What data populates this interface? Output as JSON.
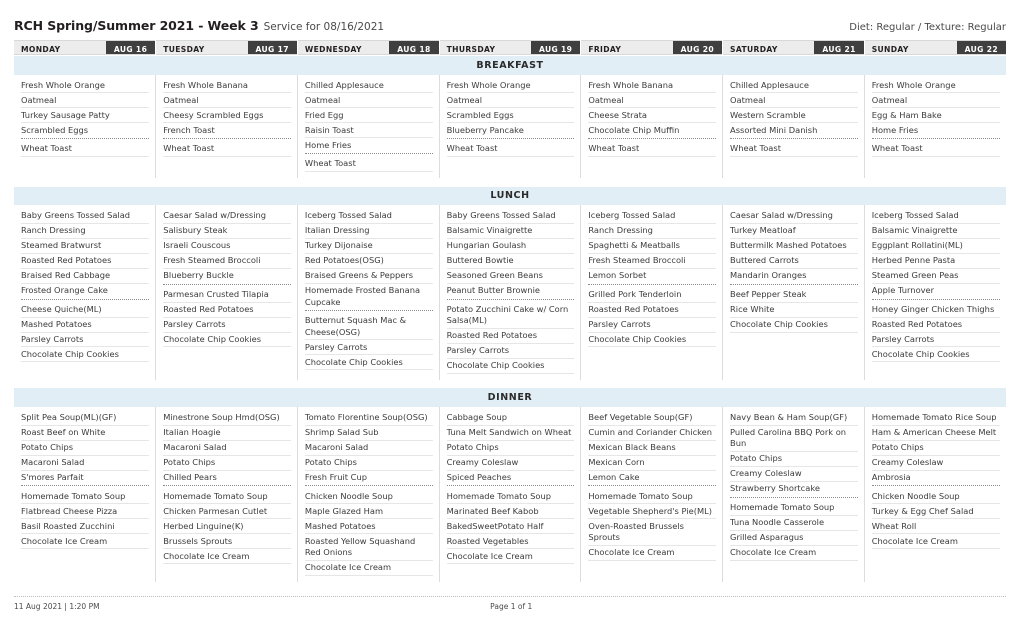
{
  "header": {
    "title": "RCH Spring/Summer 2021 - Week 3",
    "service_for": "Service for 08/16/2021",
    "diet_info": "Diet: Regular / Texture: Regular"
  },
  "days": [
    {
      "name": "MONDAY",
      "date": "AUG 16"
    },
    {
      "name": "TUESDAY",
      "date": "AUG 17"
    },
    {
      "name": "WEDNESDAY",
      "date": "AUG 18"
    },
    {
      "name": "THURSDAY",
      "date": "AUG 19"
    },
    {
      "name": "FRIDAY",
      "date": "AUG 20"
    },
    {
      "name": "SATURDAY",
      "date": "AUG 21"
    },
    {
      "name": "SUNDAY",
      "date": "AUG 22"
    }
  ],
  "meals": [
    {
      "label": "BREAKFAST",
      "columns": [
        [
          "Fresh Whole Orange",
          "Oatmeal",
          "Turkey Sausage Patty",
          "Scrambled Eggs",
          "|",
          "Wheat Toast"
        ],
        [
          "Fresh Whole Banana",
          "Oatmeal",
          "Cheesy Scrambled Eggs",
          "French Toast",
          "|",
          "Wheat Toast"
        ],
        [
          "Chilled Applesauce",
          "Oatmeal",
          "Fried Egg",
          "Raisin Toast",
          "Home Fries",
          "|",
          "Wheat Toast"
        ],
        [
          "Fresh Whole Orange",
          "Oatmeal",
          "Scrambled Eggs",
          "Blueberry Pancake",
          "|",
          "Wheat Toast"
        ],
        [
          "Fresh Whole Banana",
          "Oatmeal",
          "Cheese Strata",
          "Chocolate Chip Muffin",
          "|",
          "Wheat Toast"
        ],
        [
          "Chilled Applesauce",
          "Oatmeal",
          "Western Scramble",
          "Assorted Mini Danish",
          "|",
          "Wheat Toast"
        ],
        [
          "Fresh Whole Orange",
          "Oatmeal",
          "Egg & Ham Bake",
          "Home Fries",
          "|",
          "Wheat Toast"
        ]
      ]
    },
    {
      "label": "LUNCH",
      "columns": [
        [
          "Baby Greens Tossed Salad",
          "Ranch Dressing",
          "Steamed Bratwurst",
          "Roasted Red Potatoes",
          "Braised Red Cabbage",
          "Frosted Orange Cake",
          "|",
          "Cheese Quiche(ML)",
          "Mashed Potatoes",
          "Parsley Carrots",
          "Chocolate Chip Cookies"
        ],
        [
          "Caesar Salad w/Dressing",
          "Salisbury Steak",
          "Israeli Couscous",
          "Fresh Steamed Broccoli",
          "Blueberry Buckle",
          "|",
          "Parmesan Crusted Tilapia",
          "Roasted Red Potatoes",
          "Parsley Carrots",
          "Chocolate Chip Cookies"
        ],
        [
          "Iceberg Tossed Salad",
          "Italian Dressing",
          "Turkey Dijonaise",
          "Red Potatoes(OSG)",
          "Braised Greens & Peppers",
          "Homemade Frosted Banana Cupcake",
          "|",
          "Butternut Squash Mac & Cheese(OSG)",
          "Parsley Carrots",
          "Chocolate Chip Cookies"
        ],
        [
          "Baby Greens Tossed Salad",
          "Balsamic Vinaigrette",
          "Hungarian Goulash",
          "Buttered Bowtie",
          "Seasoned Green Beans",
          "Peanut Butter Brownie",
          "|",
          "Potato Zucchini Cake w/ Corn Salsa(ML)",
          "Roasted Red Potatoes",
          "Parsley Carrots",
          "Chocolate Chip Cookies"
        ],
        [
          "Iceberg Tossed Salad",
          "Ranch Dressing",
          "Spaghetti & Meatballs",
          "Fresh Steamed Broccoli",
          "Lemon Sorbet",
          "|",
          "Grilled Pork Tenderloin",
          "Roasted Red Potatoes",
          "Parsley Carrots",
          "Chocolate Chip Cookies"
        ],
        [
          "Caesar Salad w/Dressing",
          "Turkey Meatloaf",
          "Buttermilk Mashed Potatoes",
          "Buttered Carrots",
          "Mandarin Oranges",
          "|",
          "Beef Pepper Steak",
          "Rice White",
          "Chocolate Chip Cookies"
        ],
        [
          "Iceberg Tossed Salad",
          "Balsamic Vinaigrette",
          "Eggplant Rollatini(ML)",
          "Herbed Penne Pasta",
          "Steamed Green Peas",
          "Apple Turnover",
          "|",
          "Honey Ginger Chicken Thighs",
          "Roasted Red Potatoes",
          "Parsley Carrots",
          "Chocolate Chip Cookies"
        ]
      ]
    },
    {
      "label": "DINNER",
      "columns": [
        [
          "Split Pea Soup(ML)(GF)",
          "Roast Beef on White",
          "Potato Chips",
          "Macaroni Salad",
          "S'mores Parfait",
          "|",
          "Homemade Tomato Soup",
          "Flatbread Cheese Pizza",
          "Basil Roasted Zucchini",
          "Chocolate Ice Cream"
        ],
        [
          "Minestrone Soup Hmd(OSG)",
          "Italian Hoagie",
          "Macaroni Salad",
          "Potato Chips",
          "Chilled Pears",
          "|",
          "Homemade Tomato Soup",
          "Chicken Parmesan Cutlet",
          "Herbed Linguine(K)",
          "Brussels Sprouts",
          "Chocolate Ice Cream"
        ],
        [
          "Tomato Florentine Soup(OSG)",
          "Shrimp Salad Sub",
          "Macaroni Salad",
          "Potato Chips",
          "Fresh Fruit Cup",
          "|",
          "Chicken Noodle Soup",
          "Maple Glazed Ham",
          "Mashed Potatoes",
          "Roasted Yellow Squashand Red Onions",
          "Chocolate Ice Cream"
        ],
        [
          "Cabbage Soup",
          "Tuna Melt Sandwich on Wheat",
          "Potato Chips",
          "Creamy Coleslaw",
          "Spiced Peaches",
          "|",
          "Homemade Tomato Soup",
          "Marinated Beef Kabob",
          "BakedSweetPotato Half",
          "Roasted Vegetables",
          "Chocolate Ice Cream"
        ],
        [
          "Beef Vegetable Soup(GF)",
          "Cumin and Coriander Chicken",
          "Mexican Black Beans",
          "Mexican Corn",
          "Lemon Cake",
          "|",
          "Homemade Tomato Soup",
          "Vegetable Shepherd's Pie(ML)",
          "Oven-Roasted Brussels Sprouts",
          "Chocolate Ice Cream"
        ],
        [
          "Navy Bean & Ham Soup(GF)",
          "Pulled Carolina BBQ Pork on Bun",
          "Potato Chips",
          "Creamy Coleslaw",
          "Strawberry Shortcake",
          "|",
          "Homemade Tomato Soup",
          "Tuna Noodle Casserole",
          "Grilled Asparagus",
          "Chocolate Ice Cream"
        ],
        [
          "Homemade Tomato Rice Soup",
          "Ham & American Cheese Melt",
          "Potato Chips",
          "Creamy Coleslaw",
          "Ambrosia",
          "|",
          "Chicken Noodle Soup",
          "Turkey & Egg Chef Salad",
          "Wheat Roll",
          "Chocolate Ice Cream"
        ]
      ]
    }
  ],
  "footer": {
    "timestamp": "11 Aug 2021 | 1:20 PM",
    "page_indicator": "Page 1 of 1"
  }
}
